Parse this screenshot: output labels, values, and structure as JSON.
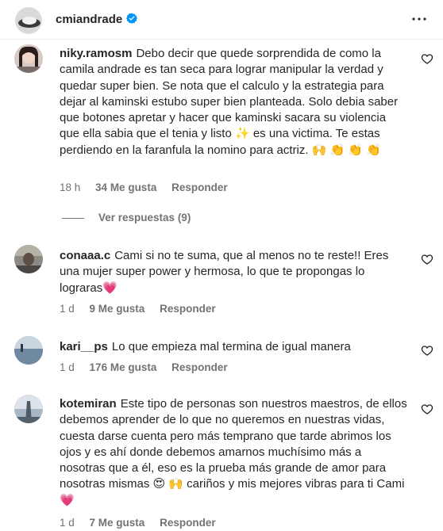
{
  "post_header": {
    "username": "cmiandrade",
    "verified_icon": "verified-badge-icon",
    "more_icon": "more-options-icon",
    "accent": "#0095f6"
  },
  "comments": [
    {
      "username": "niky.ramosm",
      "text": "Debo decir que quede sorprendida de como la camila andrade es tan seca para lograr manipular la verdad y quedar super bien. Se nota que el calculo y la estrategia para dejar al kaminski estubo super bien planteada. Solo debia saber que botones apretar y hacer que kaminski sacara su violencia que ella sabia que el tenia y listo ✨ es una victima. Te estas perdiendo en la faranfula la nomino para actriz. 🙌 👏 👏 👏",
      "time": "18 h",
      "likes": "34 Me gusta",
      "reply": "Responder",
      "view_replies": "Ver respuestas (9)"
    },
    {
      "username": "conaaa.c",
      "text": "Cami si no te suma, que al menos no te reste!! Eres una mujer super power y hermosa, lo que te propongas lo lograras💗",
      "time": "1 d",
      "likes": "9 Me gusta",
      "reply": "Responder"
    },
    {
      "username": "kari__ps",
      "text": "Lo que empieza mal termina de igual manera",
      "time": "1 d",
      "likes": "176 Me gusta",
      "reply": "Responder"
    },
    {
      "username": "kotemiran",
      "text": "Este tipo de personas son nuestros maestros, de ellos debemos aprender de lo que no queremos en nuestras vidas, cuesta darse cuenta pero más temprano que tarde abrimos los ojos y es ahí donde debemos amarnos muchísimo más a nosotras que a él, eso es la prueba más grande de amor para nosotras mismas 😍 🙌 cariños y mis mejores vibras para ti Cami 💗",
      "time": "1 d",
      "likes": "7 Me gusta",
      "reply": "Responder"
    }
  ],
  "heart_icon": "heart-outline-icon"
}
